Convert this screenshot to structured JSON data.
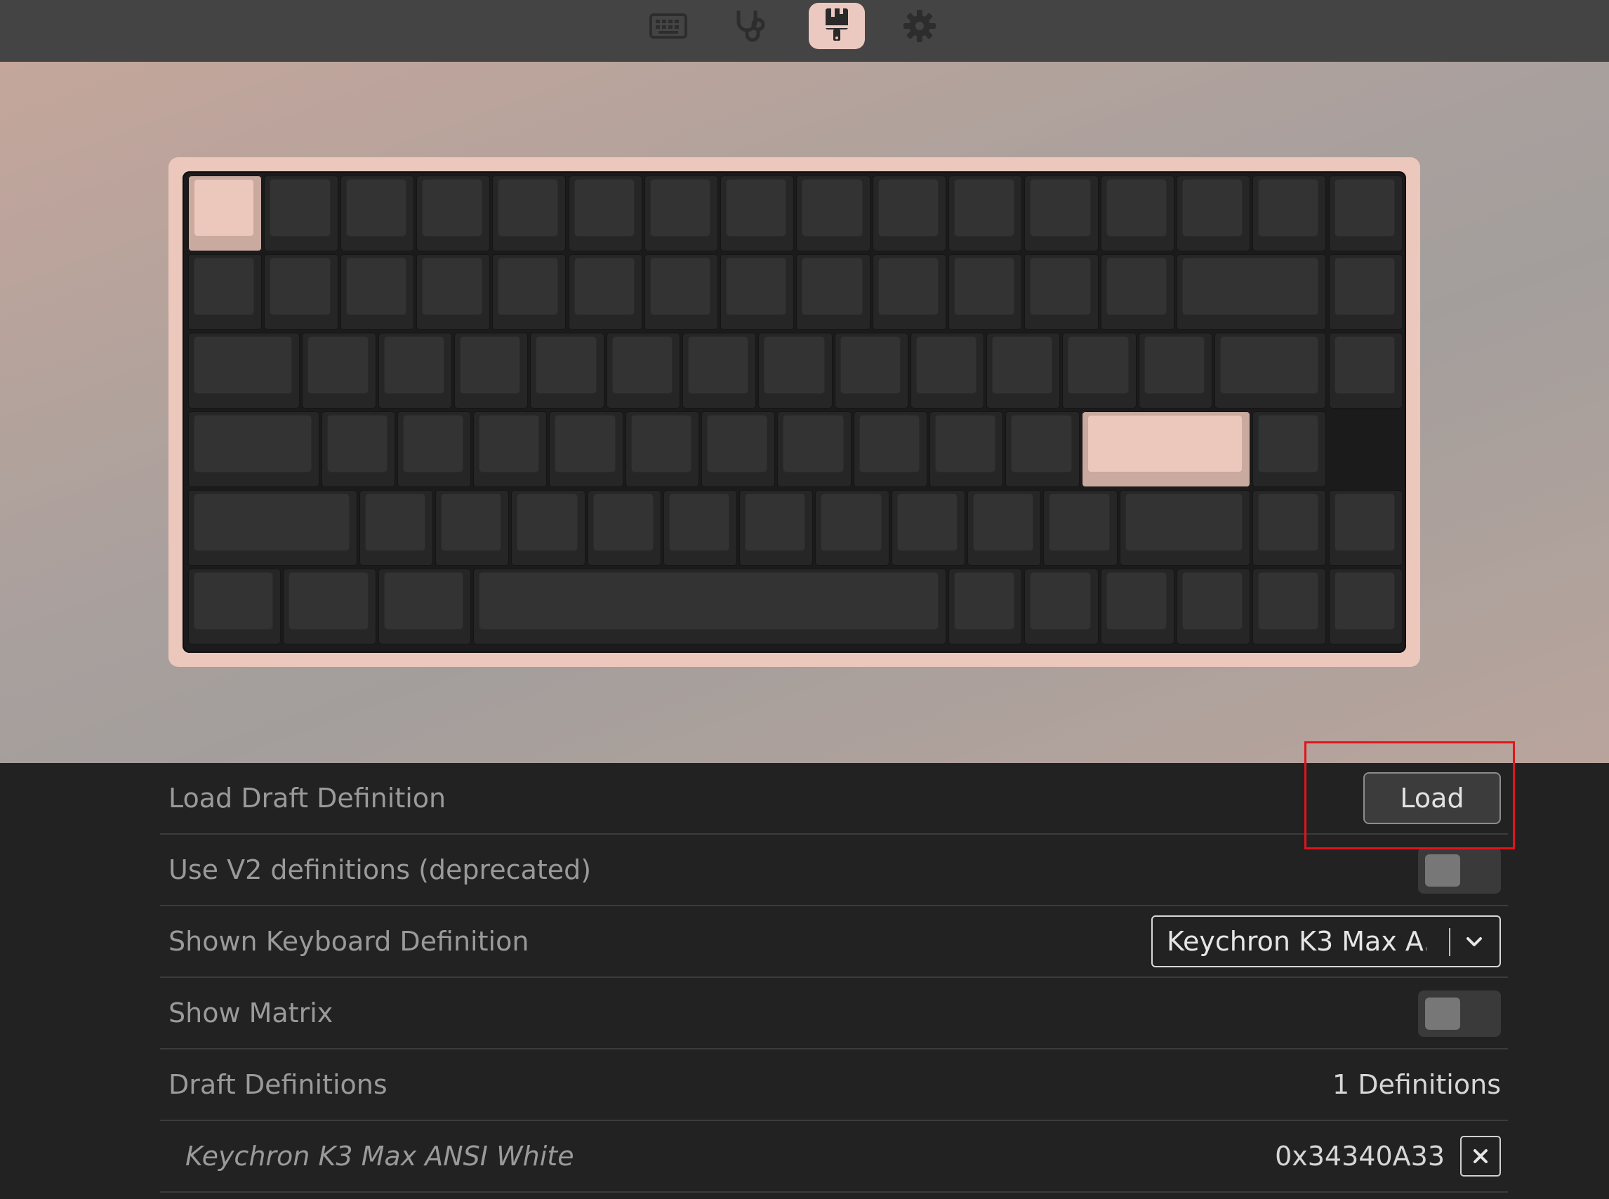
{
  "nav": {
    "icons": [
      "keyboard-icon",
      "stethoscope-icon",
      "paintbrush-icon",
      "gear-icon"
    ],
    "active": "paintbrush-icon"
  },
  "colors": {
    "accent": "#ecc7bc",
    "key_dark": "#333333",
    "panel_bg": "#222222",
    "highlight_box": "#e0151b"
  },
  "keyboard": {
    "highlighted_keys": [
      "row-1-key-1",
      "row-4-key-12"
    ]
  },
  "settings": {
    "load_draft": {
      "label": "Load Draft Definition",
      "button": "Load"
    },
    "use_v2": {
      "label": "Use V2 definitions (deprecated)",
      "enabled": false
    },
    "shown_definition": {
      "label": "Shown Keyboard Definition",
      "value": "Keychron K3 Max A..."
    },
    "show_matrix": {
      "label": "Show Matrix",
      "enabled": false
    },
    "draft_definitions": {
      "label": "Draft Definitions",
      "count": "1 Definitions"
    },
    "definition_item": {
      "name": "Keychron K3 Max ANSI White",
      "id": "0x34340A33"
    }
  }
}
